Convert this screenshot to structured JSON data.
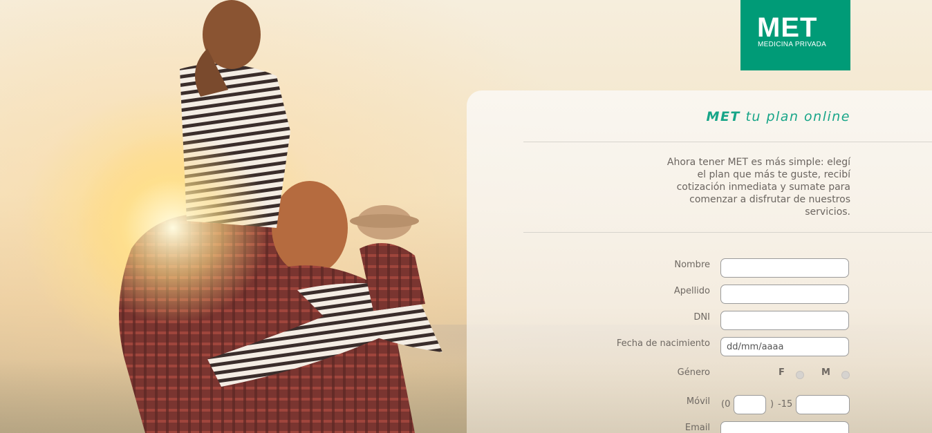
{
  "brand": {
    "logo_main": "MET",
    "logo_sub": "MEDICINA PRIVADA",
    "color": "#009b77"
  },
  "headline": {
    "brand": "MET",
    "rest": "tu plan online"
  },
  "description": "Ahora tener MET es más simple: elegí el plan que más te guste, recibí cotización inmediata y sumate para comenzar a disfrutar de nuestros servicios.",
  "form": {
    "nombre_label": "Nombre",
    "apellido_label": "Apellido",
    "dni_label": "DNI",
    "fecha_label": "Fecha de nacimiento",
    "fecha_placeholder": "dd/mm/aaaa",
    "genero_label": "Género",
    "genero_f": "F",
    "genero_m": "M",
    "movil_label": "Móvil",
    "movil_prefix_open": "(0",
    "movil_prefix_close": ")",
    "movil_prefix_15": "-15",
    "email_label": "Email"
  }
}
